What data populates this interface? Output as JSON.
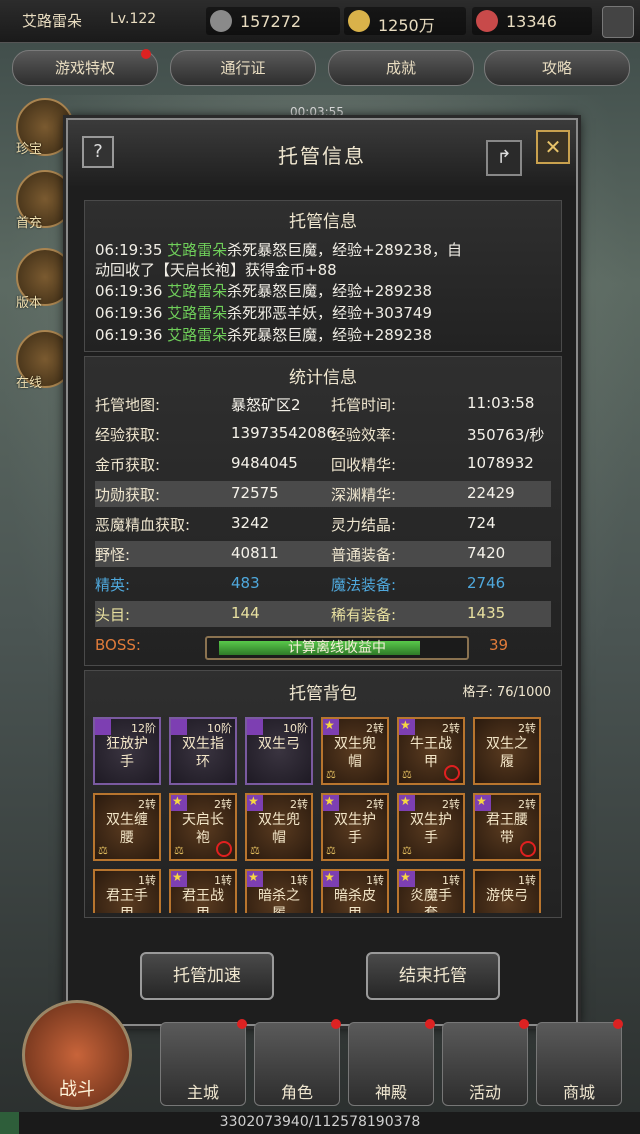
{
  "player": {
    "name": "艾路雷朵",
    "level": "Lv.122"
  },
  "resources": [
    {
      "icon": "combat-power-icon",
      "value": "157272"
    },
    {
      "icon": "gold-coin-icon",
      "value": "1250万"
    },
    {
      "icon": "gem-icon",
      "value": "13346"
    }
  ],
  "top_tabs": [
    "游戏特权",
    "通行证",
    "成就",
    "攻略"
  ],
  "side_left": [
    "珍宝",
    "首充",
    "版本",
    "在线"
  ],
  "timer": "00:03:55",
  "modal": {
    "title": "托管信息",
    "help": "?",
    "close": "✕",
    "log": {
      "title": "托管信息",
      "entries": [
        {
          "time": "06:19:35",
          "who": "艾路雷朵",
          "text": "杀死暴怒巨魔，经验+289238，自",
          "cont": "动回收了【天启长袍】获得金币+88"
        },
        {
          "time": "06:19:36",
          "who": "艾路雷朵",
          "text": "杀死暴怒巨魔，经验+289238",
          "cont": ""
        },
        {
          "time": "06:19:36",
          "who": "艾路雷朵",
          "text": "杀死邪恶羊妖，经验+303749",
          "cont": ""
        },
        {
          "time": "06:19:36",
          "who": "艾路雷朵",
          "text": "杀死暴怒巨魔，经验+289238",
          "cont": ""
        }
      ]
    },
    "stats": {
      "title": "统计信息",
      "rows": [
        {
          "l1": "托管地图:",
          "v1": "暴怒矿区2",
          "l2": "托管时间:",
          "v2": "11:03:58"
        },
        {
          "l1": "经验获取:",
          "v1": "13973542086",
          "l2": "经验效率:",
          "v2": "350763/秒"
        },
        {
          "l1": "金币获取:",
          "v1": "9484045",
          "l2": "回收精华:",
          "v2": "1078932"
        },
        {
          "l1": "功勋获取:",
          "v1": "72575",
          "l2": "深渊精华:",
          "v2": "22429"
        },
        {
          "l1": "恶魔精血获取:",
          "v1": "3242",
          "l2": "灵力结晶:",
          "v2": "724"
        },
        {
          "l1": "野怪:",
          "v1": "40811",
          "l2": "普通装备:",
          "v2": "7420"
        },
        {
          "l1": "精英:",
          "v1": "483",
          "l2": "魔法装备:",
          "v2": "2746"
        },
        {
          "l1": "头目:",
          "v1": "144",
          "l2": "稀有装备:",
          "v2": "1435"
        }
      ],
      "boss": {
        "label": "BOSS:",
        "progress_text": "计算离线收益中",
        "progress": 0.85,
        "value": "39"
      }
    },
    "bag": {
      "title": "托管背包",
      "capacity": "格子: 76/1000",
      "items": [
        {
          "name": "狂放护手",
          "tier": "12阶",
          "badge": "weapon"
        },
        {
          "name": "双生指环",
          "tier": "10阶",
          "badge": "weapon"
        },
        {
          "name": "双生弓",
          "tier": "10阶",
          "badge": "weapon"
        },
        {
          "name": "双生兜帽",
          "tier": "2转",
          "badge": "star",
          "scale": true
        },
        {
          "name": "牛王战甲",
          "tier": "2转",
          "badge": "star",
          "scale": true,
          "ban": true
        },
        {
          "name": "双生之履",
          "tier": "2转"
        },
        {
          "name": "双生缠腰",
          "tier": "2转",
          "scale": true
        },
        {
          "name": "天启长袍",
          "tier": "2转",
          "badge": "star",
          "scale": true,
          "ban": true
        },
        {
          "name": "双生兜帽",
          "tier": "2转",
          "badge": "star",
          "scale": true
        },
        {
          "name": "双生护手",
          "tier": "2转",
          "badge": "star",
          "scale": true
        },
        {
          "name": "双生护手",
          "tier": "2转",
          "badge": "star",
          "scale": true
        },
        {
          "name": "君王腰带",
          "tier": "2转",
          "badge": "star",
          "ban": true
        },
        {
          "name": "君王手甲",
          "tier": "1转"
        },
        {
          "name": "君王战甲",
          "tier": "1转",
          "badge": "star"
        },
        {
          "name": "暗杀之履",
          "tier": "1转",
          "badge": "star"
        },
        {
          "name": "暗杀皮甲",
          "tier": "1转",
          "badge": "star"
        },
        {
          "name": "炎魔手套",
          "tier": "1转",
          "badge": "star"
        },
        {
          "name": "游侠弓",
          "tier": "1转"
        }
      ]
    },
    "buttons": {
      "speed": "托管加速",
      "end": "结束托管"
    }
  },
  "bottom_nav": {
    "battle": "战斗",
    "items": [
      "主城",
      "角色",
      "神殿",
      "活动",
      "商城"
    ]
  },
  "exp": {
    "text": "3302073940/112578190378",
    "fraction": 0.029
  }
}
